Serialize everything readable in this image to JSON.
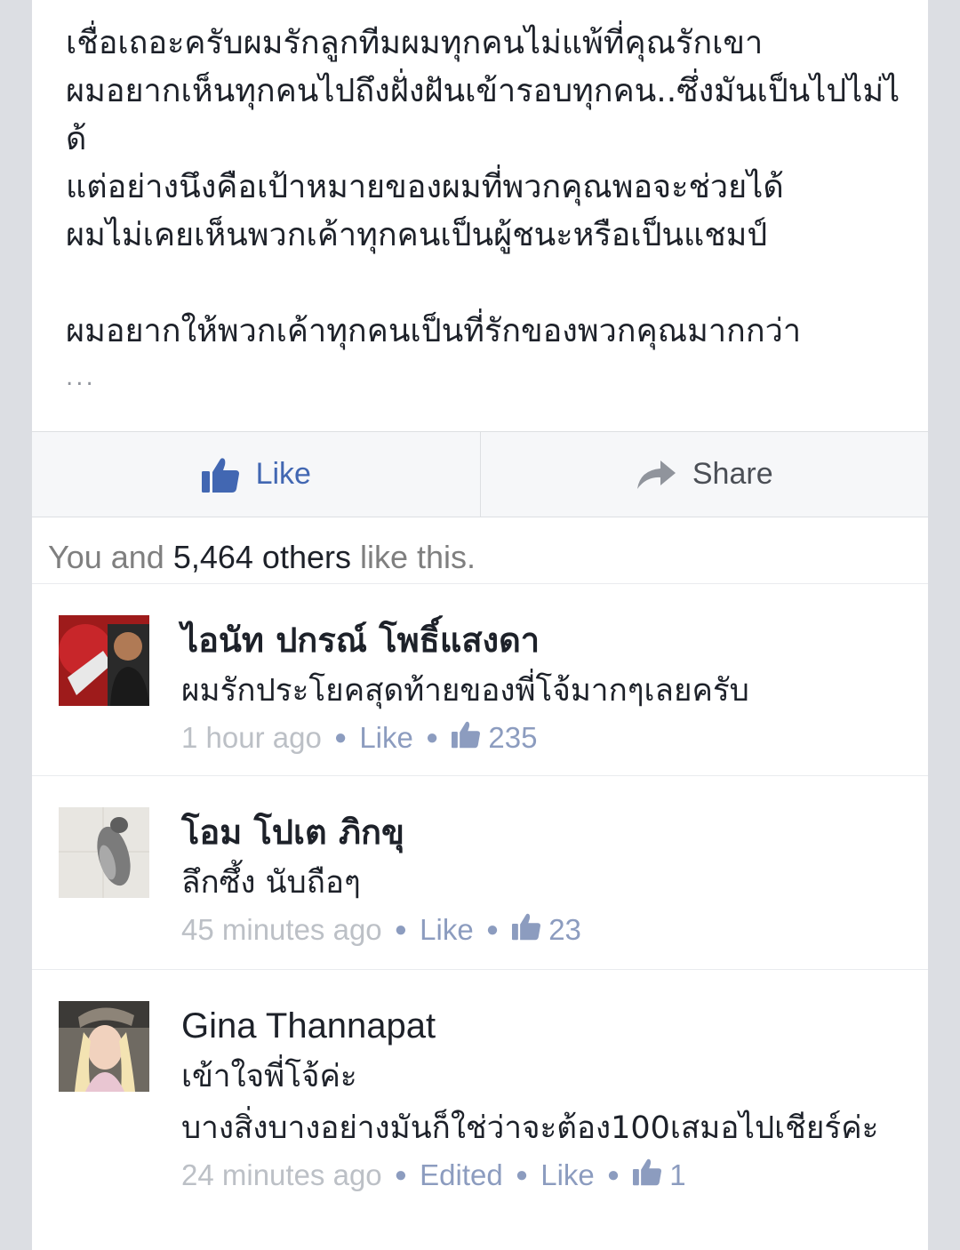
{
  "post": {
    "text": "เชื่อเถอะครับผมรักลูกทีมผมทุกคนไม่แพ้ที่คุณรักเขา\nผมอยากเห็นทุกคนไปถึงฝั่งฝันเข้ารอบทุกคน..ซึ่งมันเป็นไปไม่ได้\nแต่อย่างนึงคือเป้าหมายของผมที่พวกคุณพอจะช่วยได้\nผมไม่เคยเห็นพวกเค้าทุกคนเป็นผู้ชนะหรือเป็นแชมป์\n\nผมอยากให้พวกเค้าทุกคนเป็นที่รักของพวกคุณมากกว่า",
    "ellipsis": "..."
  },
  "actions": {
    "like_label": "Like",
    "share_label": "Share"
  },
  "likes_summary": {
    "prefix": "You and ",
    "count": "5,464 others",
    "suffix": " like this."
  },
  "comments": [
    {
      "author": "ไอนัท ปกรณ์ โพธิ์แสงดา",
      "text": "ผมรักประโยคสุดท้ายของพี่โจ้มากๆเลยครับ",
      "time": "1 hour ago",
      "like_label": "Like",
      "like_count": "235"
    },
    {
      "author": "โอม โปเต ภิกขุ",
      "text": "ลึกซึ้ง นับถือๆ",
      "time": "45 minutes ago",
      "like_label": "Like",
      "like_count": "23"
    },
    {
      "author": "Gina Thannapat",
      "text": "เข้าใจพี่โจ้ค่ะ\nบางสิ่งบางอย่างมันก็ใช่ว่าจะต้อง100เสมอไปเชียร์ค่ะ",
      "time": "24 minutes ago",
      "edited_label": "Edited",
      "like_label": "Like",
      "like_count": "1"
    }
  ],
  "icons": {
    "like_icon": "thumbs-up-icon",
    "share_icon": "share-arrow-icon"
  },
  "colors": {
    "link_blue": "#4267b2",
    "meta_blue": "#8c9cbf",
    "text": "#1d2129"
  }
}
